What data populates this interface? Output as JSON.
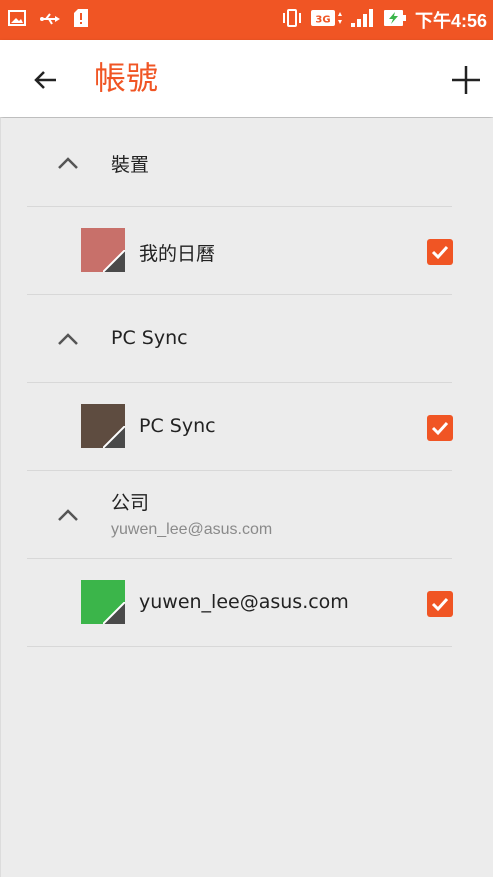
{
  "status_bar": {
    "time": "下午4:56",
    "network": "3G",
    "accent_color": "#f05524"
  },
  "app_bar": {
    "title": "帳號",
    "back_icon": "arrow-left-icon",
    "add_icon": "plus-icon"
  },
  "groups": [
    {
      "title": "裝置",
      "subtitle": "",
      "calendar": {
        "name": "我的日曆",
        "color": "#c8706a",
        "checked": true
      }
    },
    {
      "title": "PC Sync",
      "subtitle": "",
      "calendar": {
        "name": "PC Sync",
        "color": "#5e4c40",
        "checked": true
      }
    },
    {
      "title": "公司",
      "subtitle": "yuwen_lee@asus.com",
      "calendar": {
        "name": "yuwen_lee@asus.com",
        "color": "#3bb54a",
        "checked": true
      }
    }
  ]
}
